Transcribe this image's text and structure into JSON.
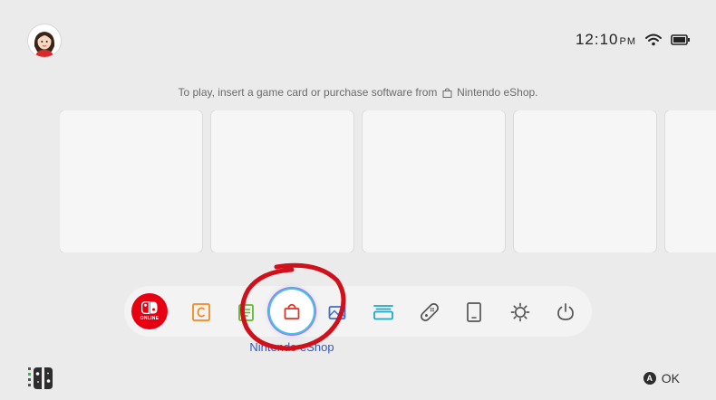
{
  "status": {
    "time": "12:10",
    "ampm": "PM",
    "wifi_icon": "wifi-icon",
    "battery_icon": "battery-icon"
  },
  "notice": {
    "text_before": "To play, insert a game card or purchase software from",
    "text_after": "Nintendo eShop."
  },
  "dock": {
    "items": [
      {
        "name": "nintendo-switch-online",
        "label": "ONLINE"
      },
      {
        "name": "news"
      },
      {
        "name": "album"
      },
      {
        "name": "nintendo-eshop"
      },
      {
        "name": "controllers"
      },
      {
        "name": "virtual-game-cards"
      },
      {
        "name": "album-2"
      },
      {
        "name": "system-settings"
      },
      {
        "name": "sleep-mode"
      },
      {
        "name": "power"
      }
    ],
    "selected_label": "Nintendo eShop"
  },
  "footer": {
    "ok_button": "A",
    "ok_label": "OK"
  },
  "colors": {
    "background": "#ebebeb",
    "online_red": "#e60012",
    "selection_blue": "#2e59c9",
    "annotation_red": "#d0101a"
  }
}
